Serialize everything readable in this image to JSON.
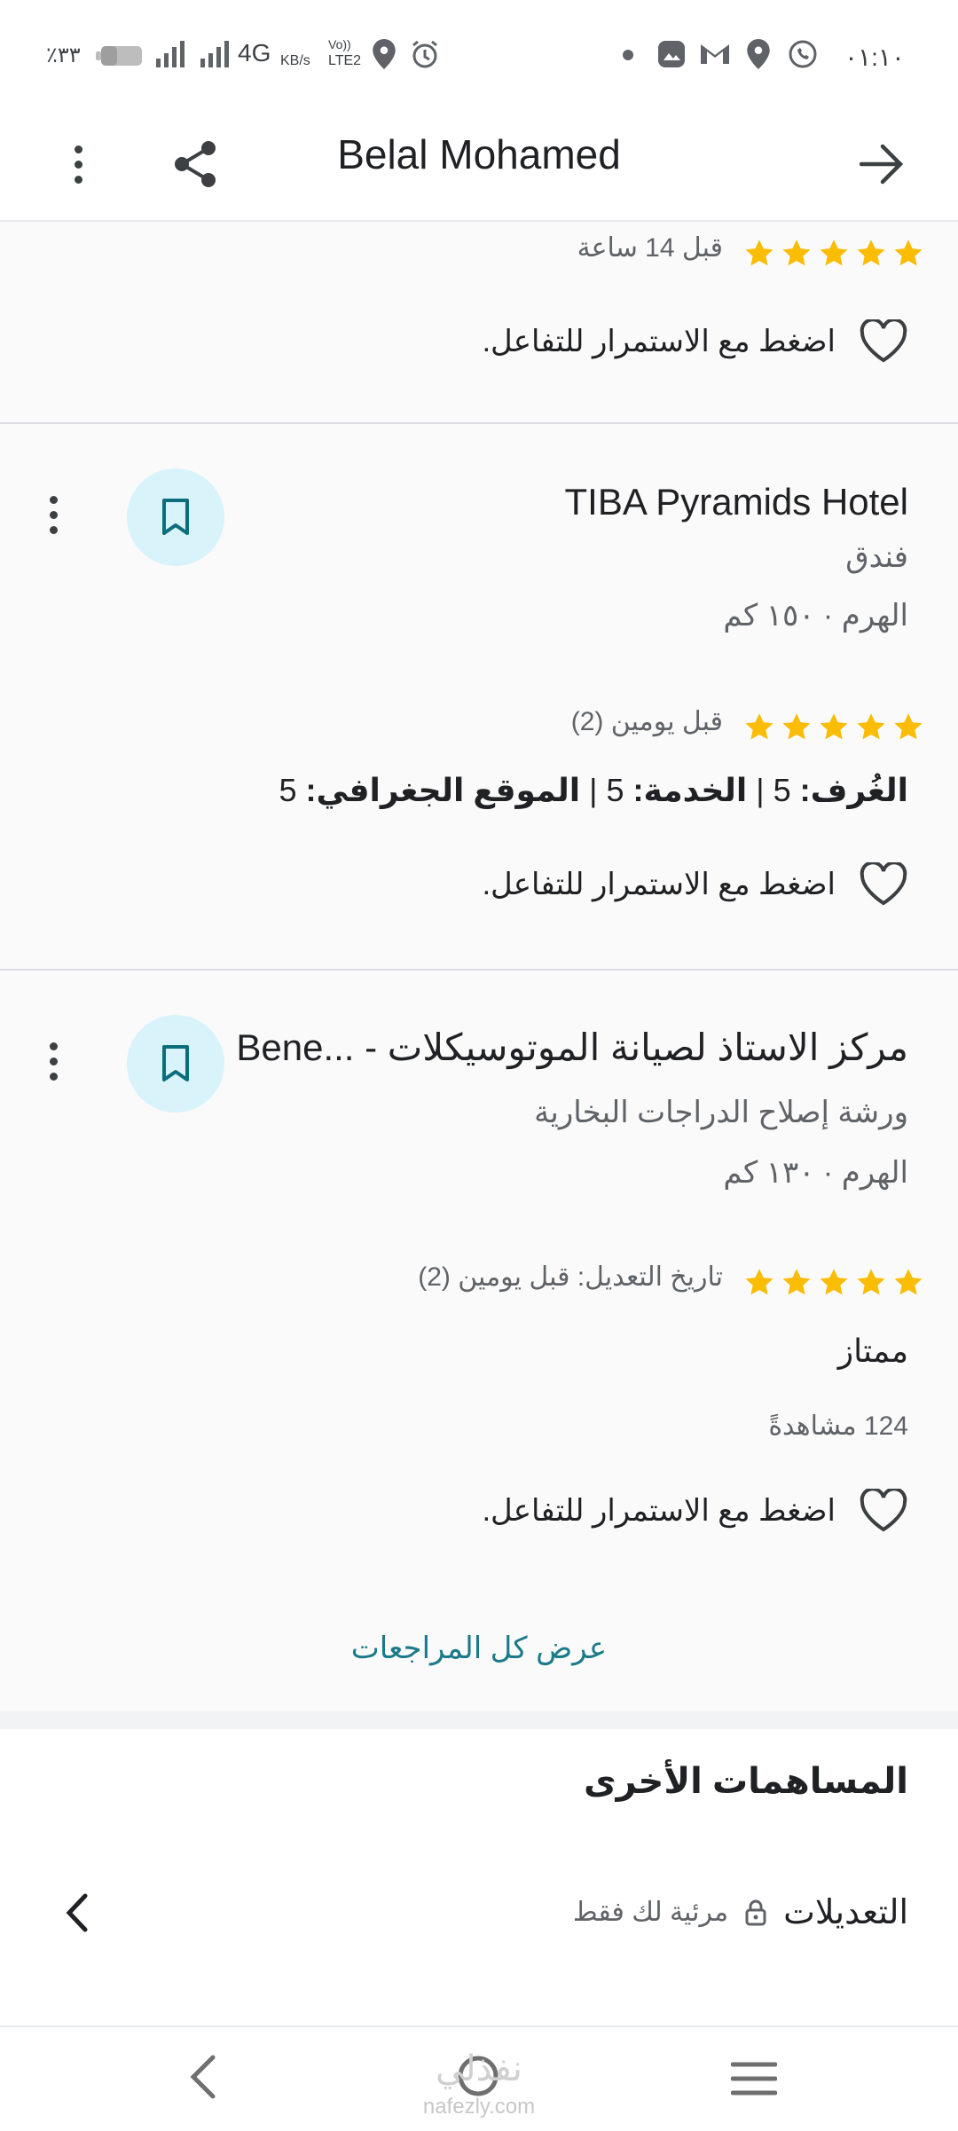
{
  "status_bar": {
    "battery_percent": "٪٣٣",
    "network": "4G",
    "speed_unit": "KB/s",
    "lte": "LTE2",
    "volte": "Vo))",
    "time": "٠١:١٠"
  },
  "appbar": {
    "title": "Belal Mohamed"
  },
  "reviews": [
    {
      "rating": 5,
      "time": "قبل 14 ساعة",
      "interact": "اضغط مع الاستمرار للتفاعل."
    },
    {
      "place": "TIBA Pyramids Hotel",
      "category": "فندق",
      "location": "الهرم · ١٥٠ كم",
      "rating": 5,
      "time": "قبل يومين (2)",
      "breakdown_rooms_label": "الغُرف:",
      "breakdown_rooms_value": "5",
      "breakdown_service_label": "الخدمة:",
      "breakdown_service_value": "5",
      "breakdown_location_label": "الموقع الجغرافي:",
      "breakdown_location_value": "5",
      "interact": "اضغط مع الاستمرار للتفاعل."
    },
    {
      "place": "مركز الاستاذ لصيانة الموتوسيكلات - ...Bene",
      "category": "ورشة إصلاح الدراجات البخارية",
      "location": "الهرم · ١٣٠ كم",
      "rating": 5,
      "time": "تاريخ التعديل: قبل يومين (2)",
      "text": "ممتاز",
      "views": "124 مشاهدةً",
      "interact": "اضغط مع الاستمرار للتفاعل."
    }
  ],
  "see_all": "عرض كل المراجعات",
  "other_contributions": {
    "title": "المساهمات الأخرى",
    "edits_label": "التعديلات",
    "edits_visibility": "مرئية لك فقط"
  },
  "watermark": {
    "arabic": "نفذلي",
    "latin": "nafezly.com"
  },
  "colors": {
    "star": "#fbbc04",
    "accent_link": "#1a7a8a",
    "save_circle": "#d9f3fb",
    "save_icon": "#0b6e7a"
  },
  "icons": {
    "back": "arrow-right-icon",
    "share": "share-icon",
    "more": "more-vertical-icon",
    "save": "bookmark-icon",
    "like": "heart-icon",
    "lock": "lock-icon",
    "chevron": "chevron-left-icon"
  }
}
